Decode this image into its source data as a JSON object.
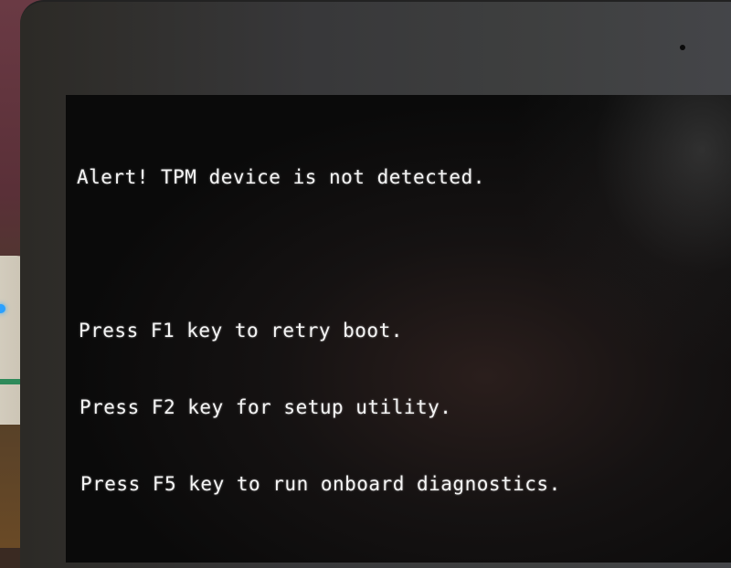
{
  "screen": {
    "alert_message": "Alert! TPM device is not detected.",
    "options": [
      {
        "key": "F1",
        "text": "Press F1 key to retry boot."
      },
      {
        "key": "F2",
        "text": "Press F2 key for setup utility."
      },
      {
        "key": "F5",
        "text": "Press F5 key to run onboard diagnostics."
      }
    ]
  },
  "colors": {
    "text": "#f4f4f4",
    "screen_bg": "#0a0a0a",
    "bezel": "#3e3f3f",
    "router_led": "#2aa0ff"
  }
}
